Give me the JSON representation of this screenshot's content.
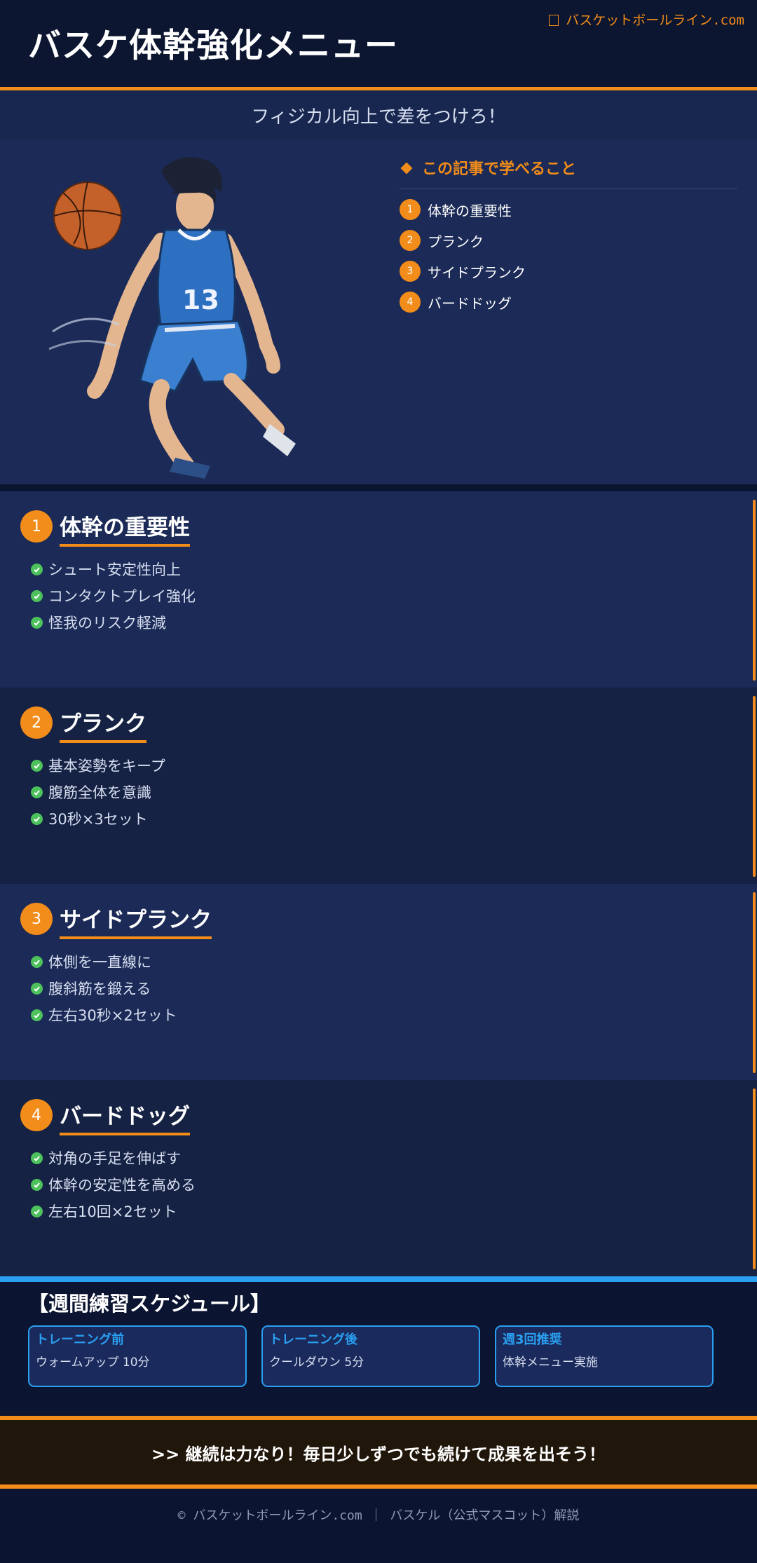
{
  "header": {
    "title": "バスケ体幹強化メニュー",
    "site_name": "バスケットボールライン.com",
    "site_icon": "image-placeholder-icon"
  },
  "subtitle": "フィジカル向上で差をつけろ！",
  "toc": {
    "heading": "この記事で学べること",
    "items": [
      {
        "num": "1",
        "label": "体幹の重要性"
      },
      {
        "num": "2",
        "label": "プランク"
      },
      {
        "num": "3",
        "label": "サイドプランク"
      },
      {
        "num": "4",
        "label": "バードドッグ"
      }
    ]
  },
  "sections": [
    {
      "num": "1",
      "title": "体幹の重要性",
      "bullets": [
        "シュート安定性向上",
        "コンタクトプレイ強化",
        "怪我のリスク軽減"
      ]
    },
    {
      "num": "2",
      "title": "プランク",
      "bullets": [
        "基本姿勢をキープ",
        "腹筋全体を意識",
        "30秒×3セット"
      ]
    },
    {
      "num": "3",
      "title": "サイドプランク",
      "bullets": [
        "体側を一直線に",
        "腹斜筋を鍛える",
        "左右30秒×2セット"
      ]
    },
    {
      "num": "4",
      "title": "バードドッグ",
      "bullets": [
        "対角の手足を伸ばす",
        "体幹の安定性を高める",
        "左右10回×2セット"
      ]
    }
  ],
  "schedule": {
    "title": "【週間練習スケジュール】",
    "cards": [
      {
        "title": "トレーニング前",
        "text": "ウォームアップ 10分"
      },
      {
        "title": "トレーニング後",
        "text": "クールダウン 5分"
      },
      {
        "title": "週3回推奨",
        "text": "体幹メニュー実施"
      }
    ]
  },
  "cta": ">> 継続は力なり！毎日少しずつでも続けて成果を出そう！",
  "footer": "© バスケットボールライン.com ｜ バスケル（公式マスコット）解説",
  "colors": {
    "accent_orange": "#f28c1a",
    "accent_blue": "#2a9ff0",
    "check_green": "#4cc15c",
    "background_navy": "#0b1530"
  }
}
